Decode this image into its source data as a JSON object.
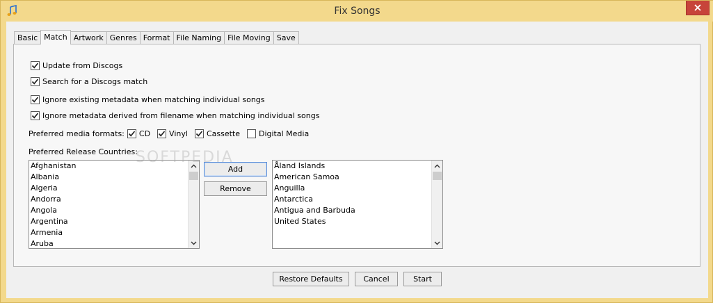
{
  "window": {
    "title": "Fix Songs",
    "close_label": "✕"
  },
  "tabs": [
    {
      "label": "Basic"
    },
    {
      "label": "Match"
    },
    {
      "label": "Artwork"
    },
    {
      "label": "Genres"
    },
    {
      "label": "Format"
    },
    {
      "label": "File Naming"
    },
    {
      "label": "File Moving"
    },
    {
      "label": "Save"
    }
  ],
  "active_tab": "Match",
  "match": {
    "options": [
      {
        "label": "Update from Discogs",
        "checked": true
      },
      {
        "label": "Search for a Discogs match",
        "checked": true
      },
      {
        "label": "Ignore existing metadata when matching individual songs",
        "checked": true
      },
      {
        "label": "Ignore metadata derived from filename when matching individual songs",
        "checked": true
      }
    ],
    "formats_label": "Preferred media formats:",
    "formats": [
      {
        "label": "CD",
        "checked": true
      },
      {
        "label": "Vinyl",
        "checked": true
      },
      {
        "label": "Cassette",
        "checked": true
      },
      {
        "label": "Digital Media",
        "checked": false
      }
    ],
    "countries_label": "Preferred Release Countries:",
    "available_countries": [
      "Afghanistan",
      "Albania",
      "Algeria",
      "Andorra",
      "Angola",
      "Argentina",
      "Armenia",
      "Aruba"
    ],
    "selected_countries": [
      "Åland Islands",
      "American Samoa",
      "Anguilla",
      "Antarctica",
      "Antigua and Barbuda",
      "United States"
    ],
    "add_label": "Add",
    "remove_label": "Remove"
  },
  "footer": {
    "restore_label": "Restore Defaults",
    "cancel_label": "Cancel",
    "start_label": "Start"
  },
  "watermark": "SOFTPEDIA"
}
